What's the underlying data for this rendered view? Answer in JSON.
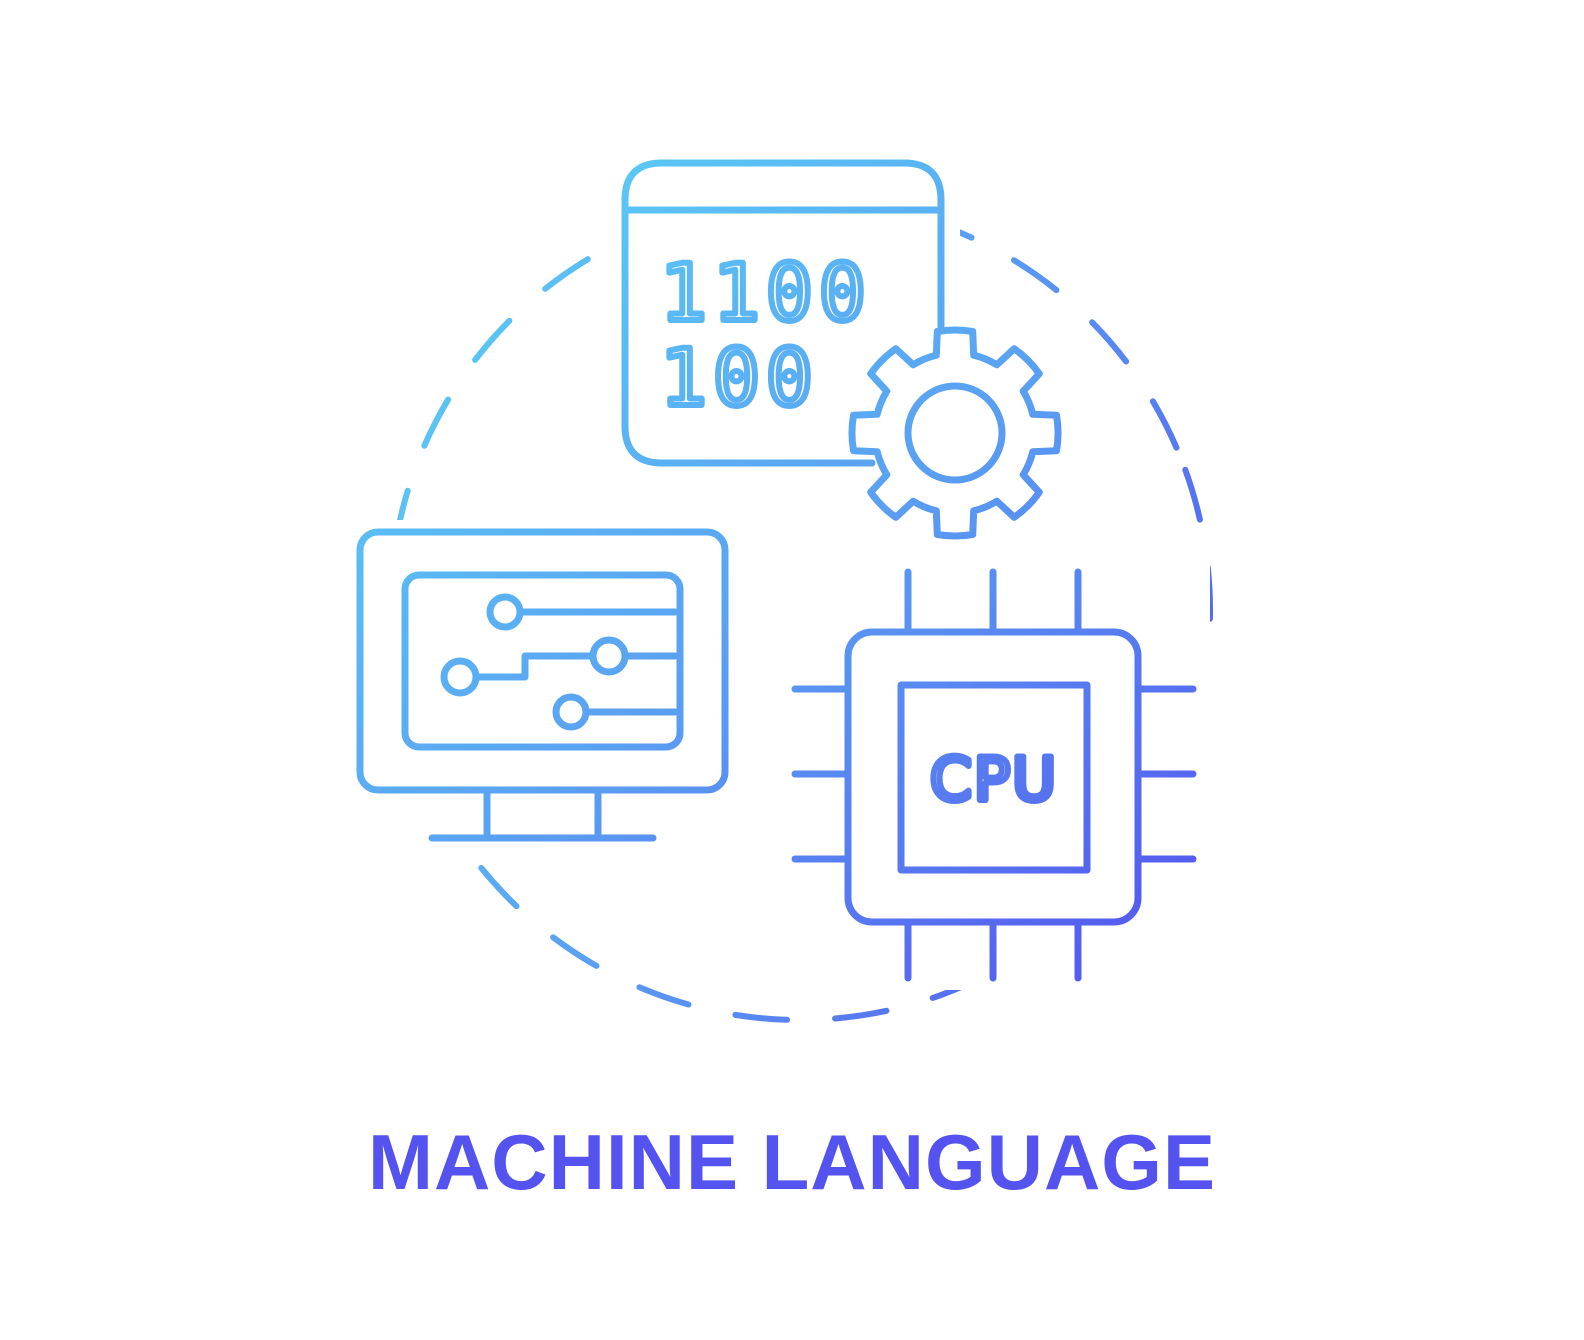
{
  "title": "MACHINE LANGUAGE",
  "binary": {
    "line1": "1100",
    "line2": "100"
  },
  "chip_label": "CPU",
  "colors": {
    "gradient_start": "#5bd2f5",
    "gradient_mid": "#5aa0f2",
    "gradient_end": "#5453ee",
    "title": "#5553ef",
    "background": "#ffffff"
  },
  "icons": [
    "binary-code-window-icon",
    "gear-icon",
    "circuit-monitor-icon",
    "cpu-chip-icon"
  ]
}
